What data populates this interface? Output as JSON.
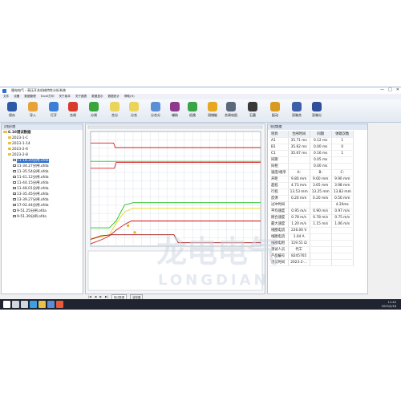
{
  "window": {
    "title": "隆电电气 - 高压开关机械特性分析系统",
    "controls": [
      "—",
      "□",
      "✕"
    ]
  },
  "menu": [
    "文件",
    "设置",
    "数据管理",
    "Excel打印",
    "关于版本",
    "关于图表",
    "数据显示",
    "数据统计",
    "帮助(H)"
  ],
  "toolbar": {
    "buttons": [
      {
        "label": "保存",
        "icon": "save-icon",
        "color": "#2c5aa6"
      },
      {
        "label": "导入",
        "icon": "import-icon",
        "color": "#e8a23a"
      },
      {
        "label": "打开",
        "icon": "open-icon",
        "color": "#3d7fd6"
      },
      {
        "label": "合闸",
        "icon": "close-circuit-icon",
        "color": "#d93a2b"
      },
      {
        "label": "分闸",
        "icon": "open-circuit-icon",
        "color": "#3aa53a"
      },
      {
        "label": "合分",
        "icon": "close-open-icon",
        "color": "#ead45c"
      },
      {
        "label": "分合",
        "icon": "open-close-icon",
        "color": "#ead45c"
      },
      {
        "label": "分合分",
        "icon": "ocо-icon",
        "color": "#5a8fd8"
      },
      {
        "label": "辅助",
        "icon": "auxiliary-icon",
        "color": "#8c3a8c"
      },
      {
        "label": "低跳",
        "icon": "low-trip-icon",
        "color": "#3aa548"
      },
      {
        "label": "测储能",
        "icon": "energy-storage-icon",
        "color": "#e6a820"
      },
      {
        "label": "合闸电阻",
        "icon": "closing-resistor-icon",
        "color": "#5a6a7a"
      },
      {
        "label": "石墨",
        "icon": "graphite-icon",
        "color": "#3a3a3a"
      },
      {
        "label": "配动",
        "icon": "linkage-icon",
        "color": "#d89a20"
      },
      {
        "label": "双端合",
        "icon": "dual-close-icon",
        "color": "#3e5fa8"
      },
      {
        "label": "双端分",
        "icon": "dual-open-icon",
        "color": "#2f4f9a"
      }
    ]
  },
  "left_panel": {
    "header": "试验列表",
    "root": "6.10测试数据",
    "items": [
      {
        "indent": 1,
        "label": "2023-1-C",
        "folder": true
      },
      {
        "indent": 1,
        "label": "2023-1-14",
        "folder": true
      },
      {
        "indent": 1,
        "label": "2023-2-6",
        "folder": true
      },
      {
        "indent": 1,
        "label": "2023-2-8",
        "folder": true
      },
      {
        "indent": 2,
        "label": "11-18.20分闸.ofda",
        "selected": true
      },
      {
        "indent": 2,
        "label": "11-34.27分闸.ofda"
      },
      {
        "indent": 2,
        "label": "11-35.54分闸.ofda"
      },
      {
        "indent": 2,
        "label": "11-41.12分闸.ofda"
      },
      {
        "indent": 2,
        "label": "11-44.15分闸.ofda"
      },
      {
        "indent": 2,
        "label": "11-48.01分闸.ofda"
      },
      {
        "indent": 2,
        "label": "13-35.45分闸.ofda"
      },
      {
        "indent": 2,
        "label": "13-39.27分闸.ofda"
      },
      {
        "indent": 2,
        "label": "17-02.44分闸.ofda"
      },
      {
        "indent": 2,
        "label": "9-51.25分闸.ofda"
      },
      {
        "indent": 2,
        "label": "9-51.39分闸.ofda"
      }
    ]
  },
  "right_panel": {
    "header": "测试数据",
    "columns": [
      "项目",
      "合闸时间",
      "同期",
      "弹跳次数"
    ],
    "rows": [
      [
        "A1",
        "35.71 ms",
        "0.12 ms",
        "1"
      ],
      [
        "B1",
        "35.62 ms",
        "0.00 ms",
        "0"
      ],
      [
        "C1",
        "35.67 ms",
        "0.16 ms",
        "1"
      ],
      [
        "同期",
        "",
        "0.05 ms",
        ""
      ],
      [
        "同相",
        "",
        "0.00 ms",
        ""
      ],
      [
        "速度/相序",
        "A:",
        "B:",
        "C:"
      ],
      [
        "开距",
        "9.80 mm",
        "9.60 mm",
        "9.90 mm"
      ],
      [
        "超程",
        "4.73 mm",
        "3.65 mm",
        "3.98 mm"
      ],
      [
        "行程",
        "13.53 mm",
        "13.25 mm",
        "13.83 mm"
      ],
      [
        "反弹",
        "0.20 mm",
        "0.20 mm",
        "0.50 mm"
      ],
      [
        "过冲时间",
        "",
        "",
        "4.20ms"
      ],
      [
        "平均速度",
        "0.95 m/s",
        "0.90 m/s",
        "0.97 m/s"
      ],
      [
        "刚合速度",
        "0.78 m/s",
        "0.78 m/s",
        "0.75 m/s"
      ],
      [
        "最大速度",
        "1.20 m/s",
        "1.15 m/s",
        "1.06 m/s"
      ],
      [
        "线圈电流",
        "226.00 V",
        "",
        ""
      ],
      [
        "线圈电流",
        "1.04 A",
        "",
        ""
      ],
      [
        "线圈电阻",
        "119.51 Ω",
        "",
        ""
      ],
      [
        "测试人员",
        "代工",
        "",
        ""
      ],
      [
        "产品编号",
        "8245765",
        "",
        ""
      ],
      [
        "测试时间",
        "2023-2-...",
        "",
        ""
      ]
    ]
  },
  "chart_data": {
    "type": "line",
    "x_range": [
      0,
      200
    ],
    "series": [
      {
        "color": "#d42020",
        "points": [
          [
            0,
            90
          ],
          [
            27,
            90
          ],
          [
            29,
            86
          ],
          [
            200,
            86
          ]
        ]
      },
      {
        "color": "#20c020",
        "points": [
          [
            0,
            74
          ],
          [
            200,
            74
          ]
        ]
      },
      {
        "color": "#d42020",
        "points": [
          [
            0,
            68
          ],
          [
            28,
            68
          ],
          [
            30,
            73
          ],
          [
            200,
            73
          ]
        ]
      },
      {
        "color": "#20c020",
        "points": [
          [
            0,
            16
          ],
          [
            22,
            16
          ],
          [
            30,
            22
          ],
          [
            40,
            36
          ],
          [
            50,
            38
          ],
          [
            200,
            38
          ]
        ]
      },
      {
        "color": "#e8d820",
        "points": [
          [
            0,
            6
          ],
          [
            22,
            10
          ],
          [
            30,
            20
          ],
          [
            40,
            30
          ],
          [
            50,
            33
          ],
          [
            200,
            33
          ]
        ]
      },
      {
        "color": "#d42020",
        "points": [
          [
            0,
            2
          ],
          [
            14,
            6
          ],
          [
            22,
            9
          ],
          [
            30,
            14
          ],
          [
            40,
            19
          ],
          [
            48,
            22
          ],
          [
            200,
            22
          ]
        ]
      },
      {
        "color": "#a01010",
        "points": [
          [
            0,
            6
          ],
          [
            12,
            9
          ],
          [
            25,
            10
          ],
          [
            60,
            10
          ],
          [
            85,
            10
          ],
          [
            98,
            10
          ],
          [
            103,
            3
          ],
          [
            200,
            3
          ]
        ]
      }
    ]
  },
  "bottom_strip": {
    "nav": [
      "|◀",
      "◀",
      "▶",
      "▶|"
    ],
    "tabs": [
      "测试数据",
      "波形图"
    ]
  },
  "watermark": {
    "cn": "龙电电气",
    "en": "LONGDIAN"
  },
  "taskbar": {
    "icons": [
      {
        "name": "windows-start-icon",
        "color": "#ffffff"
      },
      {
        "name": "search-icon",
        "color": "#cfd6e0"
      },
      {
        "name": "task-view-icon",
        "color": "#cfd6e0"
      },
      {
        "name": "browser-icon",
        "color": "#3aa0e8"
      },
      {
        "name": "folder-icon",
        "color": "#e8c04a"
      },
      {
        "name": "store-icon",
        "color": "#5a8fd8"
      },
      {
        "name": "app-icon",
        "color": "#e85a3a"
      }
    ],
    "time": "11:42",
    "date": "2023/2/18"
  }
}
